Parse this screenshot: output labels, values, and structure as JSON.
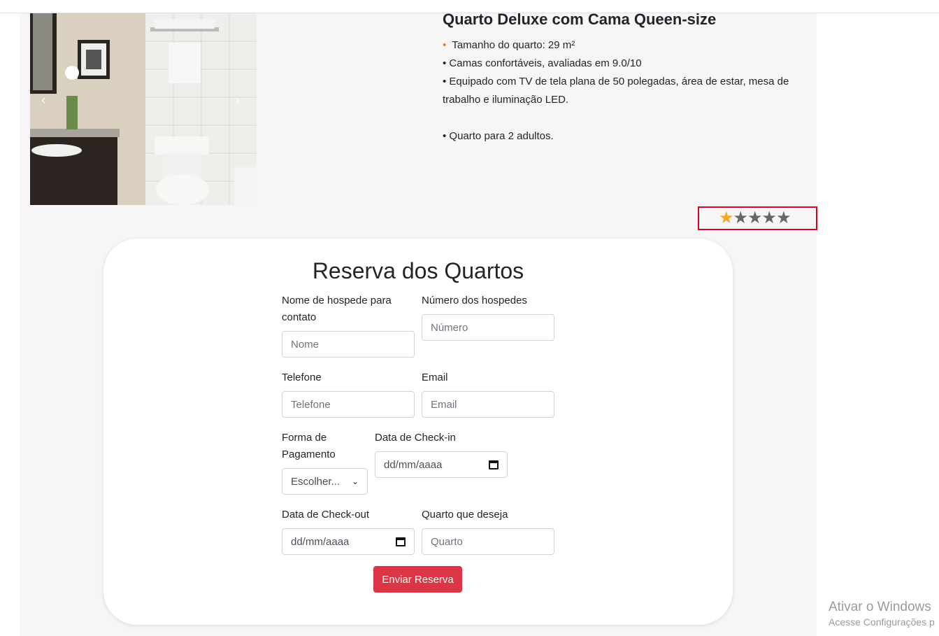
{
  "room": {
    "title": "Quarto Deluxe com Cama Queen-size",
    "features": [
      "Tamanho do quarto: 29 m²",
      "• Camas confortáveis, avaliadas em 9.0/10",
      "• Equipado com TV de tela plana de 50 polegadas, área de estar, mesa de trabalho e iluminação LED.",
      "• Quarto para 2 adultos."
    ],
    "first_bullet": "•"
  },
  "rating": {
    "value": 1,
    "max": 5,
    "star_glyph": "★",
    "filled_color": "#f5a623",
    "empty_color": "#666666"
  },
  "form": {
    "title": "Reserva dos Quartos",
    "name_label": "Nome de hospede para contato",
    "name_placeholder": "Nome",
    "guests_label": "Número dos hospedes",
    "guests_placeholder": "Número",
    "phone_label": "Telefone",
    "phone_placeholder": "Telefone",
    "email_label": "Email",
    "email_placeholder": "Email",
    "payment_label": "Forma de Pagamento",
    "payment_selected": "Escolher...",
    "checkin_label": "Data de Check-in",
    "checkin_value": "dd/mm/aaaa",
    "checkout_label": "Data de Check-out",
    "checkout_value": "dd/mm/aaaa",
    "room_label": "Quarto que deseja",
    "room_placeholder": "Quarto",
    "submit_label": "Enviar Reserva"
  },
  "watermark": {
    "line1": "Ativar o Windows",
    "line2": "Acesse Configurações p"
  },
  "colors": {
    "accent_red": "#dc3545",
    "highlight_border": "#e0001b",
    "section_bg": "#f7f5f5"
  }
}
